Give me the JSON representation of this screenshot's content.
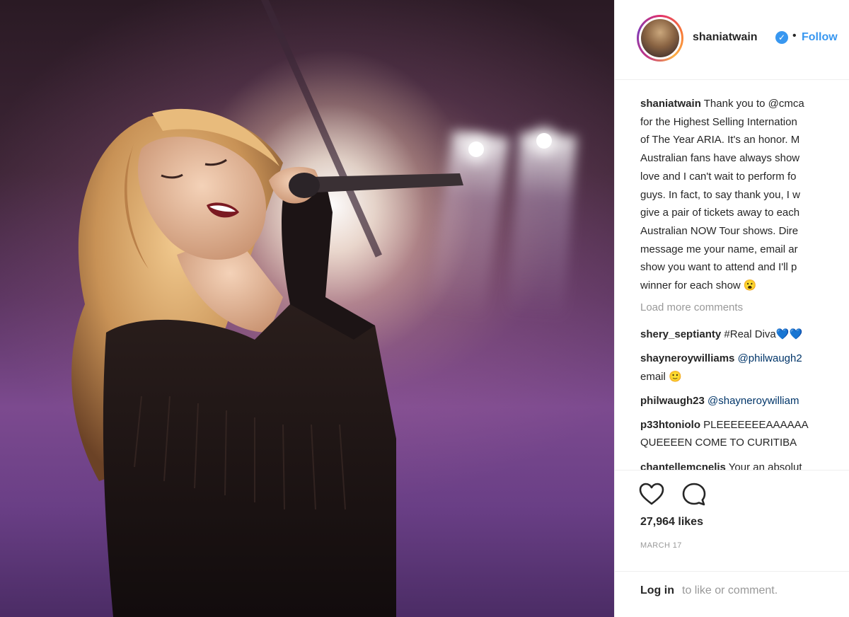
{
  "post": {
    "username": "shaniatwain",
    "verified_badge": "verified-check-icon",
    "separator": "•",
    "follow_label": "Follow"
  },
  "caption": {
    "username": "shaniatwain",
    "lines": [
      "Thank you to @cmca",
      "for the Highest Selling Internation",
      "of The Year ARIA. It's an honor. M",
      "Australian fans have always show",
      "love and I can't wait to perform fo",
      "guys. In fact, to say thank you, I w",
      "give a pair of tickets away to each",
      "Australian NOW Tour shows. Dire",
      "message me your name, email ar",
      "show you want to attend and I'll p",
      "winner for each show 😮"
    ]
  },
  "load_more": "Load more comments",
  "comments": [
    {
      "user": "shery_septianty",
      "pre": "",
      "mention": "",
      "text": "#Real Diva",
      "suffix": "💙💙"
    },
    {
      "user": "shayneroywilliams",
      "pre": "",
      "mention": "@philwaugh2",
      "text": "",
      "suffix": ""
    },
    {
      "user": "",
      "pre": "",
      "mention": "",
      "text": "email 🙂",
      "suffix": ""
    },
    {
      "user": "philwaugh23",
      "pre": "",
      "mention": "@shayneroywilliam",
      "text": "",
      "suffix": ""
    },
    {
      "user": "p33htoniolo",
      "pre": "",
      "mention": "",
      "text": "PLEEEEEEEAAAAAA",
      "suffix": ""
    },
    {
      "user": "",
      "pre": "",
      "mention": "",
      "text": "QUEEEEN COME TO CURITIBA",
      "suffix": ""
    },
    {
      "user": "chantellemcnelis",
      "pre": "",
      "mention": "",
      "text": "Your an absolut",
      "suffix": ""
    }
  ],
  "actions": {
    "like_icon": "heart-icon",
    "comment_icon": "comment-bubble-icon"
  },
  "likes": "27,964 likes",
  "date": "MARCH 17",
  "login": {
    "link": "Log in",
    "rest": "to like or comment."
  },
  "colors": {
    "accent": "#3897f0",
    "text": "#262626",
    "muted": "#999999",
    "mention": "#003569"
  }
}
